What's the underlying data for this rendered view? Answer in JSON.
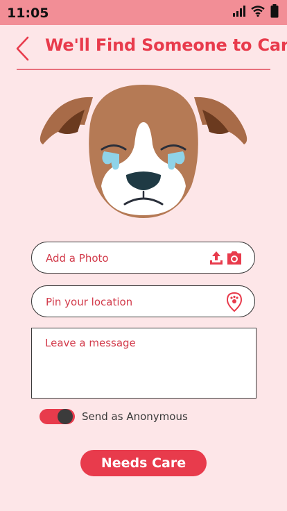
{
  "status_bar": {
    "time": "11:05",
    "icons": [
      "signal-icon",
      "wifi-icon",
      "battery-icon"
    ]
  },
  "header": {
    "title": "We'll Find Someone to Care",
    "back_icon": "chevron-left-icon"
  },
  "form": {
    "photo_placeholder": "Add a Photo",
    "location_placeholder": "Pin your location",
    "message_placeholder": "Leave a message",
    "anonymous_label": "Send as Anonymous",
    "anonymous_enabled": true,
    "submit_label": "Needs Care"
  },
  "colors": {
    "accent": "#e83b4c",
    "background": "#fde6e8",
    "status_bar": "#f28e96"
  }
}
